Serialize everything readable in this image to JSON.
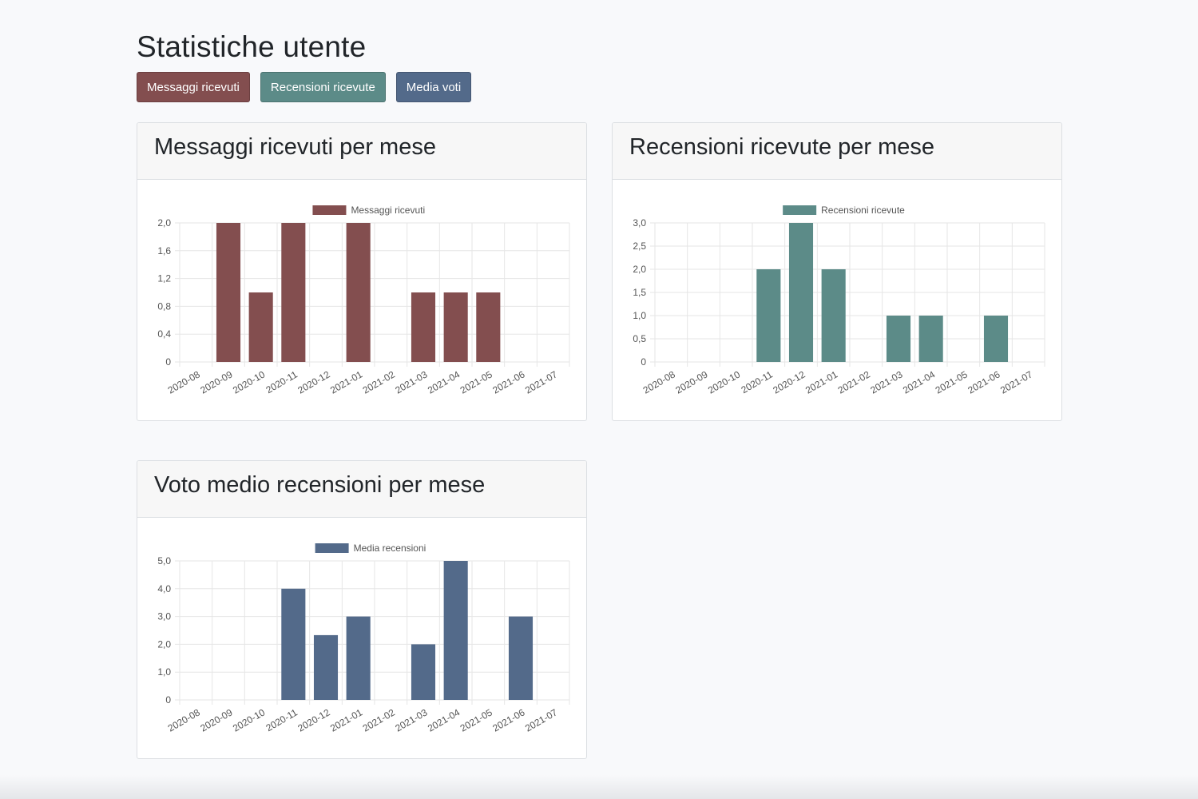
{
  "page": {
    "title": "Statistiche utente"
  },
  "buttons": [
    {
      "label": "Messaggi ricevuti",
      "color": "#834e4f"
    },
    {
      "label": "Recensioni ricevute",
      "color": "#5c8b88"
    },
    {
      "label": "Media voti",
      "color": "#536a8a"
    }
  ],
  "cards": {
    "messages": {
      "title": "Messaggi ricevuti per mese"
    },
    "reviews": {
      "title": "Recensioni ricevute per mese"
    },
    "ratings": {
      "title": "Voto medio recensioni per mese"
    }
  },
  "chart_data": [
    {
      "type": "bar",
      "title": "Messaggi ricevuti per mese",
      "categories": [
        "2020-08",
        "2020-09",
        "2020-10",
        "2020-11",
        "2020-12",
        "2021-01",
        "2021-02",
        "2021-03",
        "2021-04",
        "2021-05",
        "2021-06",
        "2021-07"
      ],
      "series": [
        {
          "name": "Messaggi ricevuti",
          "values": [
            0,
            2,
            1,
            2,
            0,
            2,
            0,
            1,
            1,
            1,
            0,
            0
          ],
          "color": "#834e4f"
        }
      ],
      "yticks": [
        "0",
        "0,4",
        "0,8",
        "1,2",
        "1,6",
        "2,0"
      ],
      "ylim": [
        0,
        2
      ],
      "legend": "top",
      "grid": true
    },
    {
      "type": "bar",
      "title": "Recensioni ricevute per mese",
      "categories": [
        "2020-08",
        "2020-09",
        "2020-10",
        "2020-11",
        "2020-12",
        "2021-01",
        "2021-02",
        "2021-03",
        "2021-04",
        "2021-05",
        "2021-06",
        "2021-07"
      ],
      "series": [
        {
          "name": "Recensioni ricevute",
          "values": [
            0,
            0,
            0,
            2,
            3,
            2,
            0,
            1,
            1,
            0,
            1,
            0
          ],
          "color": "#5c8b88"
        }
      ],
      "yticks": [
        "0",
        "0,5",
        "1,0",
        "1,5",
        "2,0",
        "2,5",
        "3,0"
      ],
      "ylim": [
        0,
        3
      ],
      "legend": "top",
      "grid": true
    },
    {
      "type": "bar",
      "title": "Voto medio recensioni per mese",
      "categories": [
        "2020-08",
        "2020-09",
        "2020-10",
        "2020-11",
        "2020-12",
        "2021-01",
        "2021-02",
        "2021-03",
        "2021-04",
        "2021-05",
        "2021-06",
        "2021-07"
      ],
      "series": [
        {
          "name": "Media recensioni",
          "values": [
            0,
            0,
            0,
            4,
            2.33,
            3,
            0,
            2,
            5,
            0,
            3,
            0
          ],
          "color": "#536a8a"
        }
      ],
      "yticks": [
        "0",
        "1,0",
        "2,0",
        "3,0",
        "4,0",
        "5,0"
      ],
      "ylim": [
        0,
        5
      ],
      "legend": "top",
      "grid": true
    }
  ]
}
